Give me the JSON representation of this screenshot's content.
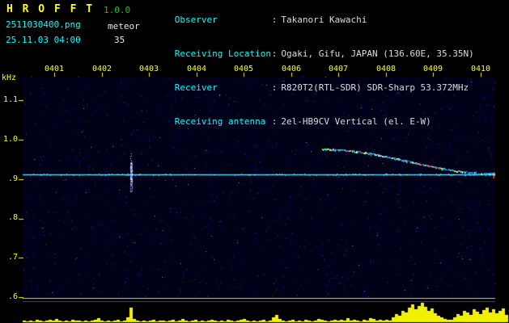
{
  "header": {
    "app_name": "H R O F F T",
    "version": "1.0.0",
    "filename": "2511030400.png",
    "mode": "meteor",
    "datetime": "25.11.03 04:00",
    "count": "35",
    "colon": ":",
    "info": [
      {
        "label": "Observer",
        "value": "Takanori Kawachi"
      },
      {
        "label": "Receiving Location",
        "value": "Ogaki, Gifu, JAPAN (136.60E, 35.35N)"
      },
      {
        "label": "Receiver",
        "value": "R820T2(RTL-SDR) SDR-Sharp 53.372MHz"
      },
      {
        "label": "Receiving antenna",
        "value": "2el-HB9CV Vertical (el. E-W)"
      }
    ]
  },
  "chart_data": {
    "type": "heatmap",
    "title": "HROFFT 10-minute meteor radio observation spectrogram",
    "ylabel": "kHz",
    "x_ticks": [
      "0401",
      "0402",
      "0403",
      "0404",
      "0405",
      "0406",
      "0407",
      "0408",
      "0409",
      "0410"
    ],
    "y_ticks": [
      "1.1",
      "1.0",
      ".9",
      ".8",
      ".7",
      ".6"
    ],
    "y_tick_values": [
      1.1,
      1.0,
      0.9,
      0.8,
      0.7,
      0.6
    ],
    "y_range": [
      0.6,
      1.16
    ],
    "carrier_khz": 0.912,
    "meteor_echo": {
      "t_start_min": 6.66,
      "t_end_min": 10.3,
      "f_start_khz": 0.975,
      "f_end_khz": 0.913
    },
    "disturbance": {
      "t_min": 2.62,
      "f_khz": 0.912
    },
    "amplitude_bars": [
      2,
      1,
      2,
      1,
      3,
      2,
      1,
      2,
      3,
      2,
      4,
      2,
      1,
      2,
      1,
      3,
      2,
      2,
      1,
      2,
      1,
      2,
      3,
      5,
      2,
      1,
      2,
      1,
      2,
      3,
      1,
      2,
      6,
      18,
      4,
      2,
      1,
      2,
      1,
      2,
      3,
      1,
      2,
      2,
      1,
      2,
      3,
      1,
      2,
      4,
      2,
      1,
      2,
      3,
      1,
      2,
      1,
      2,
      3,
      2,
      1,
      2,
      1,
      3,
      2,
      1,
      2,
      3,
      4,
      2,
      1,
      2,
      1,
      2,
      3,
      1,
      2,
      6,
      9,
      4,
      2,
      1,
      2,
      3,
      1,
      2,
      1,
      3,
      2,
      1,
      2,
      4,
      3,
      2,
      1,
      2,
      3,
      2,
      3,
      2,
      5,
      2,
      3,
      2,
      1,
      3,
      2,
      5,
      4,
      2,
      3,
      2,
      3,
      2,
      6,
      10,
      8,
      14,
      12,
      18,
      22,
      16,
      20,
      24,
      19,
      14,
      17,
      11,
      8,
      6,
      4,
      3,
      3,
      6,
      10,
      8,
      14,
      12,
      9,
      16,
      13,
      10,
      15,
      18,
      12,
      16,
      11,
      14,
      17,
      9
    ]
  },
  "colors": {
    "background": "#000000",
    "plot_background": "#000016",
    "accent_yellow": "#ffff00",
    "accent_cyan": "#00ffff",
    "accent_green": "#00cc33",
    "text_white": "#dcdcdc",
    "carrier_line": "#5ae6ff",
    "bar_yellow": "#f0f000"
  }
}
